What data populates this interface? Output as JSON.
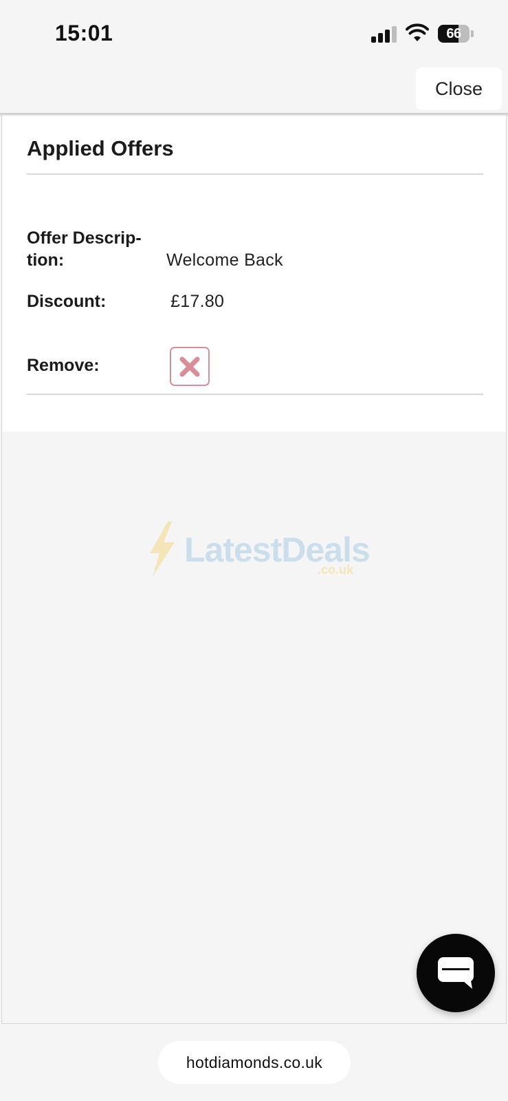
{
  "status_bar": {
    "time": "15:01",
    "battery": "66",
    "icons": [
      "cellular-signal-icon",
      "wifi-icon",
      "battery-icon"
    ]
  },
  "header": {
    "close_label": "Close"
  },
  "offers": {
    "title": "Applied Offers",
    "description_label_line1": "Offer Descrip-",
    "description_label_line2": "tion:",
    "description_value": "Welcome Back",
    "discount_label": "Discount:",
    "discount_value": "£17.80",
    "remove_label": "Remove:",
    "remove_icon": "close-x-icon",
    "remove_color": "#d98e97"
  },
  "watermark": {
    "brand": "LatestDeals",
    "domain": ".co.uk",
    "colors": {
      "text": "#a9cde6",
      "accent": "#f4d987"
    }
  },
  "chat": {
    "icon": "chat-bubble-icon"
  },
  "browser": {
    "url": "hotdiamonds.co.uk"
  }
}
